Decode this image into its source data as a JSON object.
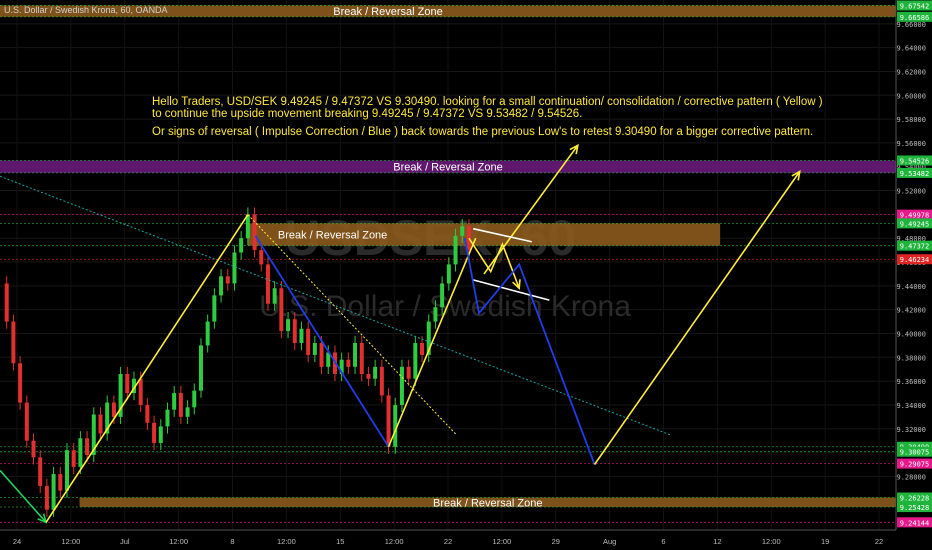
{
  "window": {
    "symbol_title": "U.S. Dollar / Swedish Krona, 60, OANDA"
  },
  "watermark": {
    "symbol": "USDSEK, 60",
    "name": "U.S. Dollar / Swedish Krona"
  },
  "annotation": {
    "line1": "Hello Traders, USD/SEK 9.49245 / 9.47372 VS 9.30490. looking for a small continuation/ consolidation / corrective  pattern ( Yellow )",
    "line2": "to continue the upside movement breaking 9.49245 / 9.47372 VS 9.53482 / 9.54526.",
    "line3": "Or signs of reversal ( Impulse Correction / Blue ) back towards the previous Low's to retest 9.30490 for a bigger corrective pattern."
  },
  "zones": [
    {
      "label": "Break / Reversal Zone",
      "color": "#8b5a1c"
    },
    {
      "label": "Break / Reversal Zone",
      "color": "#6a1b7a"
    },
    {
      "label": "Break / Reversal Zone",
      "color": "#8b5a1c"
    },
    {
      "label": "Break / Reversal Zone",
      "color": "#8b5a1c"
    }
  ],
  "colors": {
    "background": "#000000",
    "bull": "#2ecc40",
    "bear": "#e03030",
    "yellow_path": "#ffee3a",
    "blue_path": "#1f3ee8",
    "white_pattern": "#ffffff",
    "green_arrow": "#1fd35a",
    "trend_cyan": "#1aa5a5",
    "annotation_text": "#ffe83a"
  },
  "chart_data": {
    "type": "candlestick",
    "title": "U.S. Dollar / Swedish Krona, 60, OANDA",
    "y_axis": {
      "ticks": [
        9.28,
        9.3,
        9.32,
        9.34,
        9.36,
        9.38,
        9.4,
        9.42,
        9.44,
        9.46,
        9.48,
        9.5,
        9.52,
        9.54,
        9.56,
        9.58,
        9.6,
        9.62,
        9.64,
        9.66
      ],
      "tick_labels": [
        "9.28000",
        "9.30000",
        "9.32000",
        "9.34000",
        "9.36000",
        "9.38000",
        "9.40000",
        "9.42000",
        "9.44000",
        "9.46000",
        "9.48000",
        "9.50000",
        "9.52000",
        "9.54000",
        "9.56000",
        "9.58000",
        "9.60000",
        "9.62000",
        "9.64000",
        "9.66000"
      ],
      "range": [
        9.235,
        9.68
      ]
    },
    "x_axis": {
      "tick_labels": [
        "24",
        "12:00",
        "Jul",
        "12:00",
        "8",
        "12:00",
        "15",
        "12:00",
        "22",
        "12:00",
        "29",
        "Aug",
        "6",
        "12",
        "12:00",
        "19",
        "22"
      ],
      "range_hours": [
        0,
        1070
      ]
    },
    "price_badges": [
      {
        "value": "9.67542",
        "price": 9.67542,
        "bg": "#1fb43c",
        "line": "#1fb43c",
        "fg": "#ffffff"
      },
      {
        "value": "9.66586",
        "price": 9.66586,
        "bg": "#1fb43c",
        "line": "#1fb43c",
        "fg": "#ffffff"
      },
      {
        "value": "9.54526",
        "price": 9.54526,
        "bg": "#1fb43c",
        "line": "#1fb43c",
        "fg": "#ffffff"
      },
      {
        "value": "9.53482",
        "price": 9.53482,
        "bg": "#1fb43c",
        "line": "#1fb43c",
        "fg": "#ffffff"
      },
      {
        "value": "9.49978",
        "price": 9.49978,
        "bg": "#e7188a",
        "line": "#e7188a",
        "fg": "#ffffff"
      },
      {
        "value": "9.49245",
        "price": 9.49245,
        "bg": "#1fb43c",
        "line": "#1fb43c",
        "fg": "#ffffff"
      },
      {
        "value": "9.47372",
        "price": 9.47372,
        "bg": "#1fb43c",
        "line": "#1fb43c",
        "fg": "#ffffff"
      },
      {
        "value": "9.46234",
        "price": 9.46234,
        "bg": "#e02424",
        "line": "#e02424",
        "fg": "#ffffff"
      },
      {
        "value": "9.30490",
        "price": 9.3049,
        "bg": "#1fb43c",
        "line": "#1fb43c",
        "fg": "#ffffff"
      },
      {
        "value": "9.30075",
        "price": 9.30075,
        "bg": "#1fb43c",
        "line": "#1fb43c",
        "fg": "#ffffff"
      },
      {
        "value": "9.29075",
        "price": 9.29075,
        "bg": "#e7188a",
        "line": "#e7188a",
        "fg": "#ffffff"
      },
      {
        "value": "9.26228",
        "price": 9.26228,
        "bg": "#1fb43c",
        "line": "#1fb43c",
        "fg": "#ffffff"
      },
      {
        "value": "9.25428",
        "price": 9.25428,
        "bg": "#1fb43c",
        "line": "#1fb43c",
        "fg": "#ffffff"
      },
      {
        "value": "9.24144",
        "price": 9.24144,
        "bg": "#e7188a",
        "line": "#e7188a",
        "fg": "#ffffff"
      }
    ],
    "zones": [
      {
        "label": "Break / Reversal Zone",
        "from_price": 9.66586,
        "to_price": 9.67542,
        "from_hour": 0,
        "to_hour": 1070,
        "fill": "#8b5a1c"
      },
      {
        "label": "Break / Reversal Zone",
        "from_price": 9.53482,
        "to_price": 9.54526,
        "from_hour": 0,
        "to_hour": 1070,
        "fill": "#6a1b7a"
      },
      {
        "label": "Break / Reversal Zone",
        "from_price": 9.47372,
        "to_price": 9.49245,
        "from_hour": 296,
        "to_hour": 860,
        "fill": "#8b5a1c"
      },
      {
        "label": "Break / Reversal Zone",
        "from_price": 9.25428,
        "to_price": 9.26228,
        "from_hour": 95,
        "to_hour": 1070,
        "fill": "#8b5a1c"
      }
    ],
    "candles_close": [
      [
        0,
        9.442
      ],
      [
        8,
        9.41
      ],
      [
        16,
        9.375
      ],
      [
        24,
        9.342
      ],
      [
        32,
        9.31
      ],
      [
        40,
        9.296
      ],
      [
        48,
        9.272
      ],
      [
        56,
        9.252
      ],
      [
        64,
        9.282
      ],
      [
        72,
        9.268
      ],
      [
        80,
        9.302
      ],
      [
        88,
        9.288
      ],
      [
        96,
        9.312
      ],
      [
        104,
        9.298
      ],
      [
        112,
        9.332
      ],
      [
        120,
        9.316
      ],
      [
        128,
        9.342
      ],
      [
        136,
        9.33
      ],
      [
        144,
        9.366
      ],
      [
        152,
        9.35
      ],
      [
        160,
        9.362
      ],
      [
        168,
        9.34
      ],
      [
        176,
        9.325
      ],
      [
        184,
        9.308
      ],
      [
        192,
        9.322
      ],
      [
        200,
        9.336
      ],
      [
        208,
        9.35
      ],
      [
        216,
        9.33
      ],
      [
        224,
        9.338
      ],
      [
        232,
        9.352
      ],
      [
        240,
        9.39
      ],
      [
        248,
        9.41
      ],
      [
        256,
        9.432
      ],
      [
        264,
        9.448
      ],
      [
        272,
        9.442
      ],
      [
        280,
        9.468
      ],
      [
        288,
        9.48
      ],
      [
        296,
        9.49978
      ],
      [
        304,
        9.47
      ],
      [
        312,
        9.458
      ],
      [
        320,
        9.425
      ],
      [
        328,
        9.438
      ],
      [
        336,
        9.402
      ],
      [
        344,
        9.412
      ],
      [
        352,
        9.392
      ],
      [
        360,
        9.404
      ],
      [
        368,
        9.382
      ],
      [
        376,
        9.392
      ],
      [
        384,
        9.372
      ],
      [
        392,
        9.384
      ],
      [
        400,
        9.366
      ],
      [
        408,
        9.378
      ],
      [
        416,
        9.372
      ],
      [
        424,
        9.392
      ],
      [
        432,
        9.366
      ],
      [
        440,
        9.362
      ],
      [
        448,
        9.372
      ],
      [
        456,
        9.348
      ],
      [
        464,
        9.3049
      ],
      [
        472,
        9.34
      ],
      [
        480,
        9.372
      ],
      [
        488,
        9.362
      ],
      [
        496,
        9.392
      ],
      [
        504,
        9.382
      ],
      [
        512,
        9.41
      ],
      [
        520,
        9.422
      ],
      [
        528,
        9.442
      ],
      [
        536,
        9.458
      ],
      [
        544,
        9.482
      ],
      [
        552,
        9.49
      ],
      [
        560,
        9.47
      ]
    ],
    "drawings": {
      "green_arrow": [
        [
          0,
          9.285
        ],
        [
          55,
          9.24144
        ]
      ],
      "yellow_up_1": [
        [
          55,
          9.24144
        ],
        [
          296,
          9.49978
        ]
      ],
      "blue_down_1": [
        [
          305,
          9.482
        ],
        [
          464,
          9.3049
        ]
      ],
      "yellow_dash_trend": [
        [
          296,
          9.49978
        ],
        [
          545,
          9.315
        ]
      ],
      "yellow_up_2": [
        [
          464,
          9.3049
        ],
        [
          568,
          9.48
        ]
      ],
      "yellow_target_up": [
        [
          578,
          9.45
        ],
        [
          690,
          9.558
        ]
      ],
      "white_upper": [
        [
          565,
          9.488
        ],
        [
          635,
          9.477
        ]
      ],
      "white_lower": [
        [
          565,
          9.445
        ],
        [
          656,
          9.428
        ]
      ],
      "yellow_zigzag": [
        [
          560,
          9.48
        ],
        [
          586,
          9.452
        ],
        [
          600,
          9.475
        ],
        [
          620,
          9.438
        ]
      ],
      "blue_path": [
        [
          555,
          9.48
        ],
        [
          572,
          9.417
        ],
        [
          620,
          9.458
        ],
        [
          710,
          9.29
        ]
      ],
      "yellow_final_up": [
        [
          710,
          9.29
        ],
        [
          955,
          9.536
        ]
      ],
      "cyan_trend": [
        [
          0,
          9.532
        ],
        [
          800,
          9.315
        ]
      ]
    }
  }
}
